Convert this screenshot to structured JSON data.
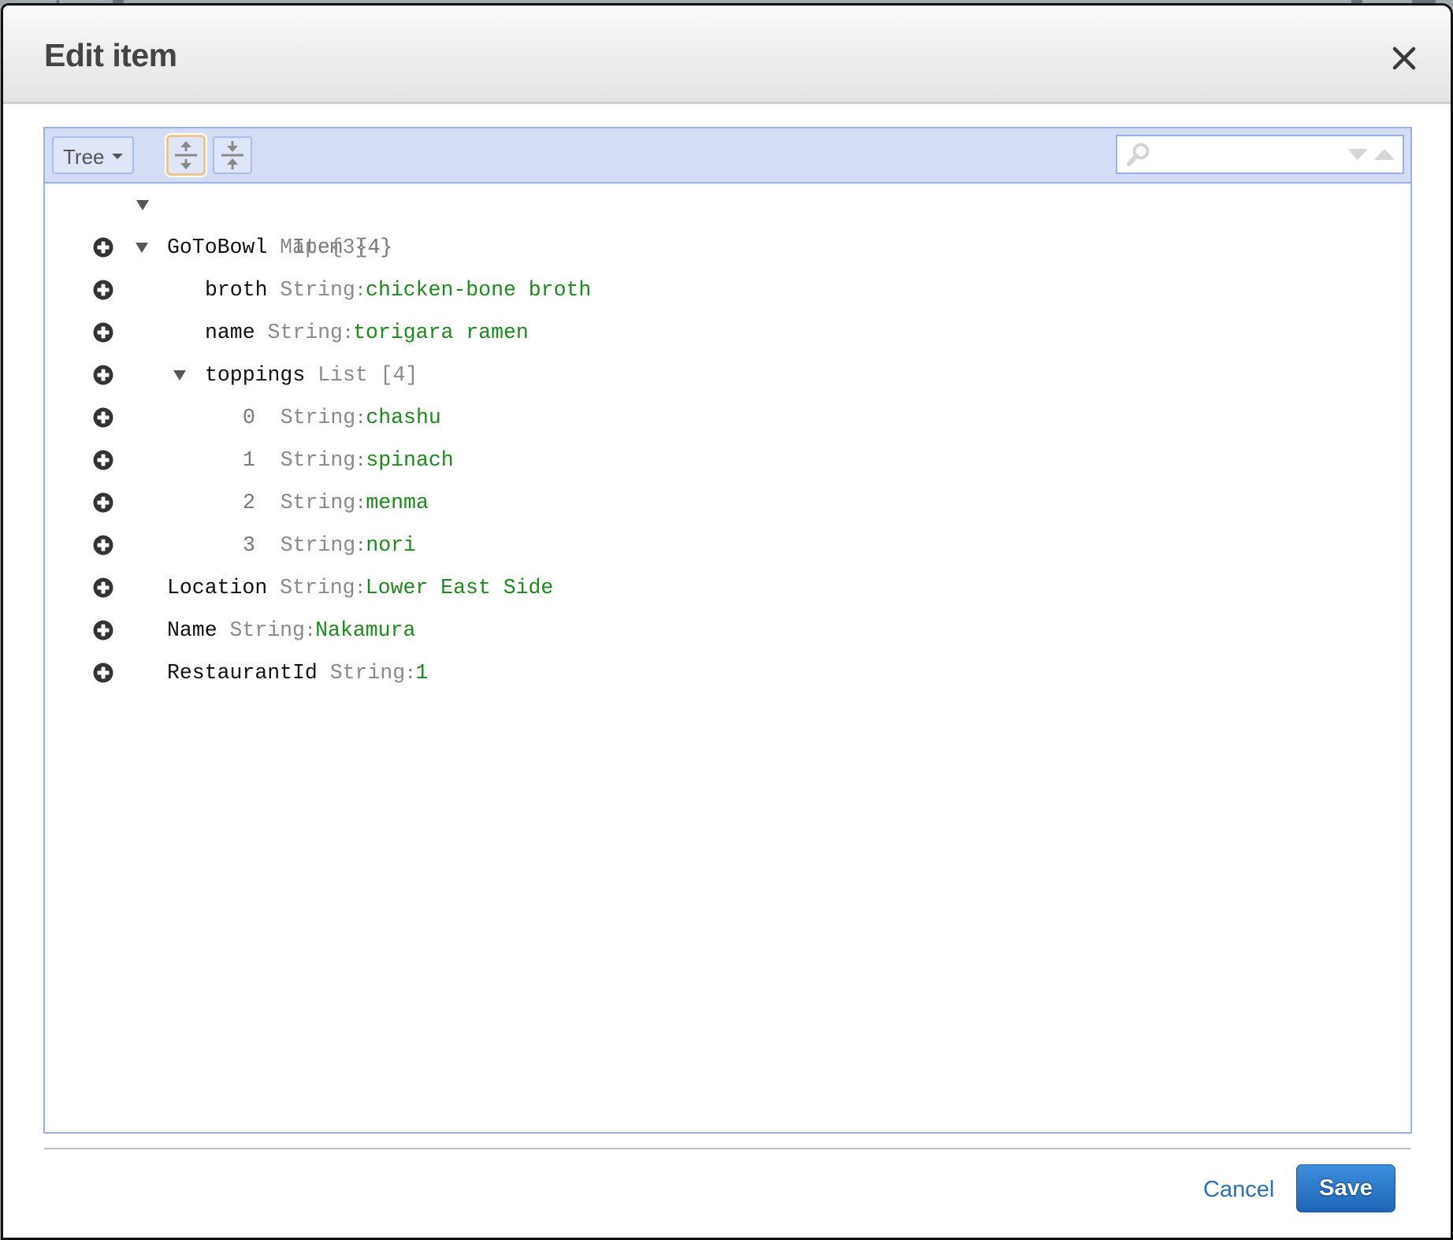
{
  "dialog": {
    "title": "Edit item",
    "close_icon": "close-icon"
  },
  "toolbar": {
    "mode_label": "Tree",
    "mode_icon": "caret-down-icon",
    "expand_all_icon": "expand-all-icon",
    "collapse_all_icon": "collapse-all-icon",
    "search": {
      "value": "",
      "placeholder": "",
      "icon": "search-icon",
      "prev_icon": "arrow-down-icon",
      "next_icon": "arrow-up-icon"
    }
  },
  "tree": {
    "root": {
      "label": "Item",
      "count": "{4}"
    },
    "rows": [
      {
        "key": "GoToBowl",
        "type": "Map",
        "count": "{3}",
        "level": 1,
        "expandable": true
      },
      {
        "key": "broth",
        "type": "String",
        "value": "chicken-bone broth",
        "level": 2
      },
      {
        "key": "name",
        "type": "String",
        "value": "torigara ramen",
        "level": 2
      },
      {
        "key": "toppings",
        "type": "List",
        "count": "[4]",
        "level": 2,
        "expandable": true
      },
      {
        "index": "0",
        "type": "String",
        "value": "chashu",
        "level": 3
      },
      {
        "index": "1",
        "type": "String",
        "value": "spinach",
        "level": 3
      },
      {
        "index": "2",
        "type": "String",
        "value": "menma",
        "level": 3
      },
      {
        "index": "3",
        "type": "String",
        "value": "nori",
        "level": 3
      },
      {
        "key": "Location",
        "type": "String",
        "value": "Lower East Side",
        "level": 1
      },
      {
        "key": "Name",
        "type": "String",
        "value": "Nakamura",
        "level": 1
      },
      {
        "key": "RestaurantId",
        "type": "String",
        "value": "1",
        "level": 1
      }
    ],
    "colon": ":"
  },
  "footer": {
    "cancel_label": "Cancel",
    "save_label": "Save"
  },
  "colors": {
    "value_text": "#1c8a1c",
    "type_text": "#8a8a8a",
    "panel_border": "#97b0f0",
    "toolbar_bg": "#d5ddf5",
    "save_bg": "#2a78c8",
    "cancel_link": "#2a70b8"
  }
}
